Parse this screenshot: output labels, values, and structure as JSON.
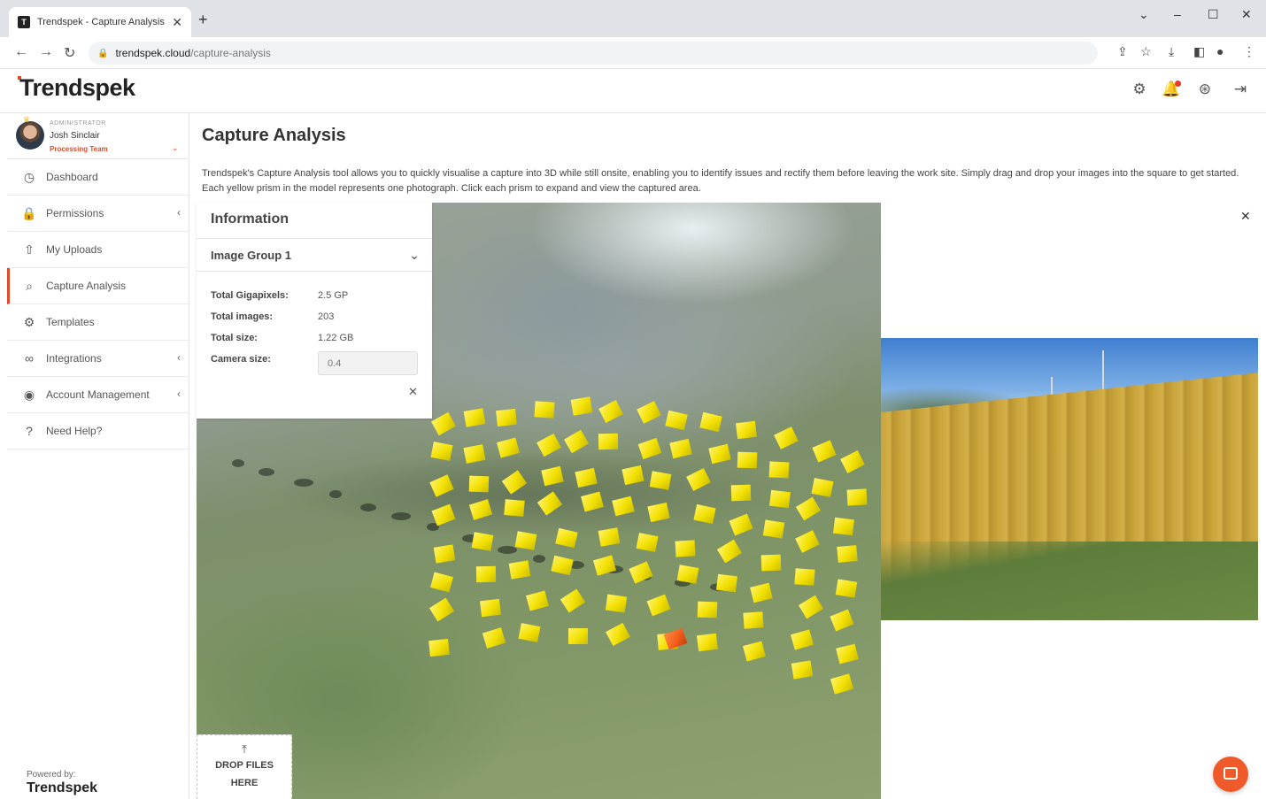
{
  "browser": {
    "tab_title": "Trendspek - Capture Analysis",
    "favicon": "T",
    "url_host": "trendspek.cloud",
    "url_path": "/capture-analysis"
  },
  "header": {
    "logo_text": "Trendspek",
    "icons": [
      "settings-icon",
      "bell-icon",
      "help-icon",
      "logout-icon"
    ]
  },
  "user": {
    "role": "ADMINISTRATOR",
    "name": "Josh Sinclair",
    "team": "Processing Team"
  },
  "sidebar": {
    "items": [
      {
        "label": "Dashboard",
        "icon": "dashboard-icon"
      },
      {
        "label": "Permissions",
        "icon": "lock-icon",
        "has_submenu": true
      },
      {
        "label": "My Uploads",
        "icon": "upload-icon"
      },
      {
        "label": "Capture Analysis",
        "icon": "search-icon",
        "active": true
      },
      {
        "label": "Templates",
        "icon": "gears-icon"
      },
      {
        "label": "Integrations",
        "icon": "link-icon",
        "has_submenu": true
      },
      {
        "label": "Account Management",
        "icon": "account-icon",
        "has_submenu": true
      },
      {
        "label": "Need Help?",
        "icon": "question-icon"
      }
    ],
    "powered_by": "Powered by:",
    "powered_logo": "Trendspek"
  },
  "main": {
    "title": "Capture Analysis",
    "description": "Trendspek's Capture Analysis tool allows you to quickly visualise a capture into 3D while still onsite, enabling you to identify issues and rectify them before leaving the work site. Simply drag and drop your images into the square to get started. Each yellow prism in the model represents one photograph. Click each prism to expand and view the captured area."
  },
  "info_panel": {
    "title": "Information",
    "group_label": "Image Group 1",
    "rows": [
      {
        "label": "Total Gigapixels:",
        "value": "2.5 GP"
      },
      {
        "label": "Total images:",
        "value": "203"
      },
      {
        "label": "Total size:",
        "value": "1.22 GB"
      }
    ],
    "camera_label": "Camera size:",
    "camera_value": "0.4"
  },
  "drop": {
    "line1": "DROP FILES",
    "line2": "HERE"
  },
  "colors": {
    "accent": "#e04b2a",
    "prism": "#f2e000",
    "prism_selected": "#f15a1a"
  }
}
